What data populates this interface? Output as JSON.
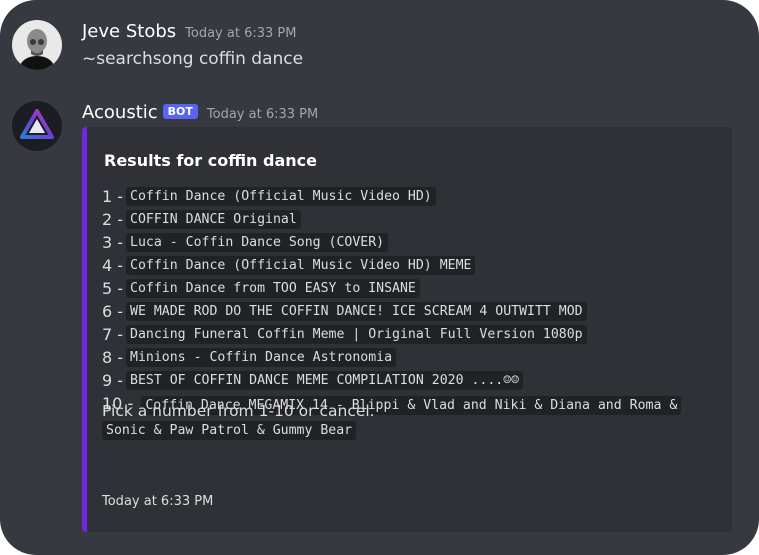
{
  "messages": [
    {
      "username": "Jeve Stobs",
      "timestamp": "Today at 6:33 PM",
      "content": "~searchsong coffin dance",
      "avatar_icon": "user-photo-avatar"
    },
    {
      "username": "Acoustic",
      "badge": "BOT",
      "timestamp": "Today at 6:33 PM",
      "avatar_icon": "acoustic-triangle-logo",
      "embed": {
        "accent_color": "#7028e4",
        "title": "Results for coffin dance",
        "results": [
          {
            "num": "1 -",
            "title": "Coffin Dance (Official Music Video HD)"
          },
          {
            "num": "2 -",
            "title": "COFFIN DANCE Original"
          },
          {
            "num": "3 -",
            "title": "Luca - Coffin Dance Song (COVER)"
          },
          {
            "num": "4 -",
            "title": "Coffin Dance (Official Music Video HD) MEME"
          },
          {
            "num": "5 -",
            "title": "Coffin Dance from TOO EASY to INSANE"
          },
          {
            "num": "6 -",
            "title": "WE MADE ROD DO THE COFFIN DANCE! ICE SCREAM 4 OUTWITT MOD"
          },
          {
            "num": "7 -",
            "title": "Dancing Funeral Coffin Meme | Original Full Version 1080p"
          },
          {
            "num": "8 -",
            "title": "Minions  - Coffin Dance Astronomia"
          },
          {
            "num": "9 -",
            "title": "BEST OF COFFIN DANCE MEME COMPILATION  2020 ....☺☺"
          },
          {
            "num": "10 -",
            "title": "Coffin Dance MEGAMIX 14 - Blippi & Vlad and Niki & Diana and Roma & Sonic & Paw Patrol & Gummy Bear"
          }
        ],
        "prompt": "Pick a number from 1-10 or cancel.",
        "footer": "Today at 6:33 PM"
      }
    }
  ],
  "colors": {
    "background": "#36393f",
    "embed_bg": "#2f3136",
    "bot_badge": "#5865f2",
    "code_bg": "#202225"
  }
}
